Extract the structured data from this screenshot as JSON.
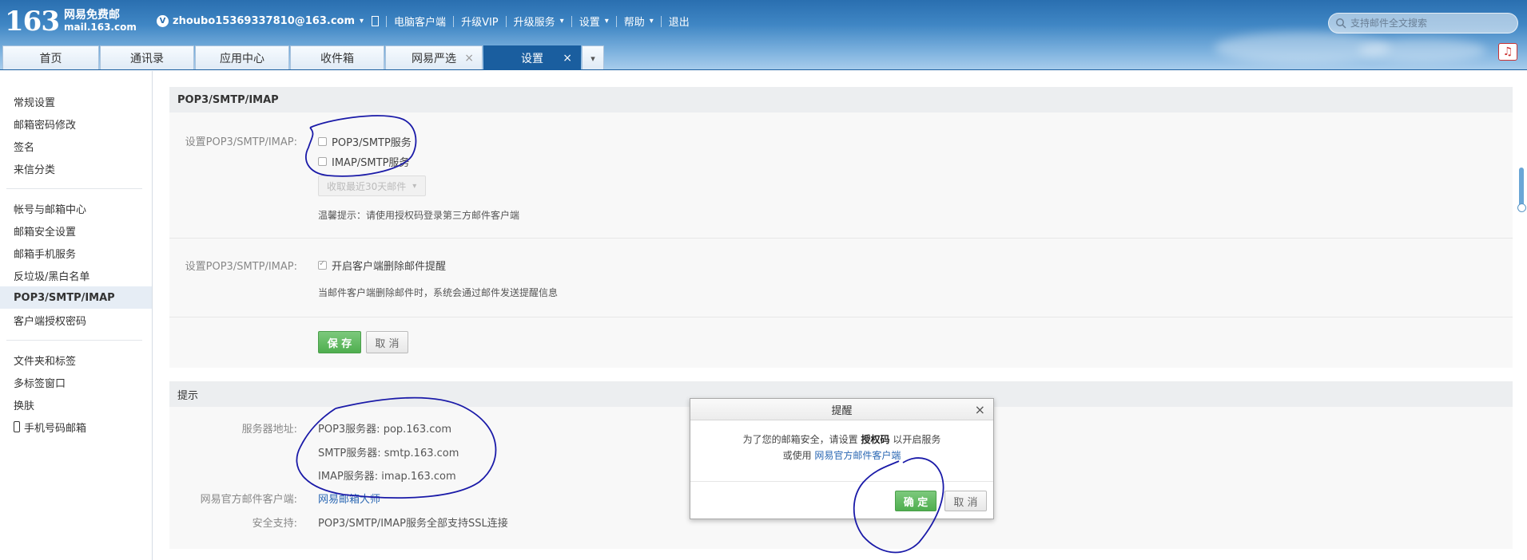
{
  "header": {
    "logo_num": "163",
    "logo_cn": "网易免费邮",
    "logo_domain": "mail.163.com",
    "user_email": "zhoubo15369337810@163.com",
    "nav": [
      "电脑客户端",
      "升级VIP",
      "升级服务",
      "设置",
      "帮助",
      "退出"
    ],
    "search_placeholder": "支持邮件全文搜索"
  },
  "tabs": [
    {
      "label": "首页"
    },
    {
      "label": "通讯录"
    },
    {
      "label": "应用中心"
    },
    {
      "label": "收件箱"
    },
    {
      "label": "网易严选"
    },
    {
      "label": "设置"
    }
  ],
  "sidebar": {
    "group1": [
      "常规设置",
      "邮箱密码修改",
      "签名",
      "来信分类"
    ],
    "group2": [
      "帐号与邮箱中心",
      "邮箱安全设置",
      "邮箱手机服务",
      "反垃圾/黑白名单",
      "POP3/SMTP/IMAP",
      "客户端授权密码"
    ],
    "group3": [
      "文件夹和标签",
      "多标签窗口",
      "换肤",
      "手机号码邮箱"
    ]
  },
  "settings": {
    "title": "POP3/SMTP/IMAP",
    "row1_label": "设置POP3/SMTP/IMAP:",
    "pop3_label": "POP3/SMTP服务",
    "imap_label": "IMAP/SMTP服务",
    "fetch_select": "收取最近30天邮件",
    "hint1": "温馨提示：请使用授权码登录第三方邮件客户端",
    "row2_label": "设置POP3/SMTP/IMAP:",
    "delete_remind_label": "开启客户端删除邮件提醒",
    "hint2": "当邮件客户端删除邮件时，系统会通过邮件发送提醒信息",
    "save_label": "保 存",
    "cancel_label": "取 消"
  },
  "tips": {
    "title": "提示",
    "server_label": "服务器地址:",
    "pop3_server": "POP3服务器: pop.163.com",
    "smtp_server": "SMTP服务器: smtp.163.com",
    "imap_server": "IMAP服务器: imap.163.com",
    "client_label": "网易官方邮件客户端:",
    "client_link": "网易邮箱大师",
    "security_label": "安全支持:",
    "security_value": "POP3/SMTP/IMAP服务全部支持SSL连接"
  },
  "dialog": {
    "title": "提醒",
    "line1_pre": "为了您的邮箱安全，请设置",
    "line1_bold": "授权码",
    "line1_post": "以开启服务",
    "line2_pre": "或使用",
    "line2_link": "网易官方邮件客户端",
    "ok_label": "确 定",
    "cancel_label": "取 消"
  },
  "colors": {
    "tab_active": "#1a5e9f",
    "ok_green": "#4fae4f",
    "link_blue": "#2a67b3",
    "annotation": "#1a1aa8"
  }
}
